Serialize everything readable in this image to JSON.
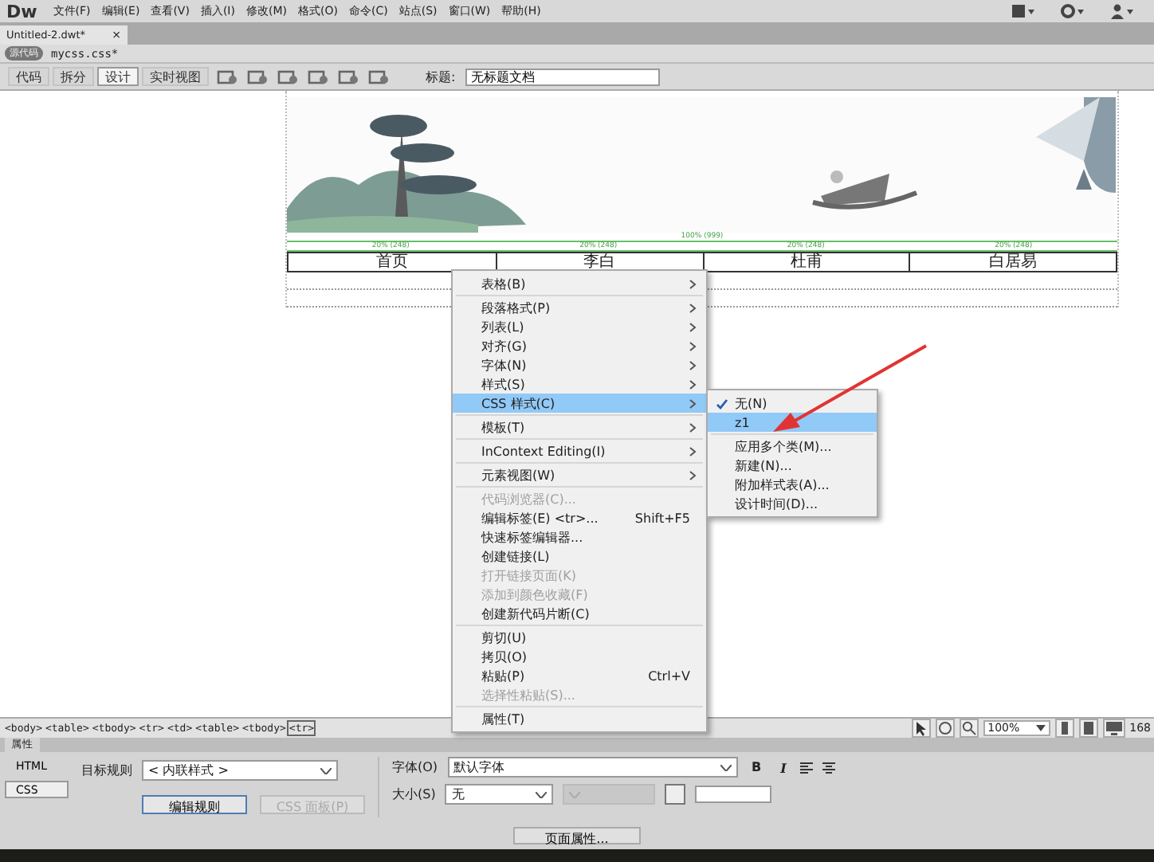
{
  "menubar": {
    "logo": "Dw",
    "menus": [
      "文件(F)",
      "编辑(E)",
      "查看(V)",
      "插入(I)",
      "修改(M)",
      "格式(O)",
      "命令(C)",
      "站点(S)",
      "窗口(W)",
      "帮助(H)"
    ]
  },
  "document_tab": {
    "title": "Untitled-2.dwt*",
    "close": "×"
  },
  "related_files": {
    "source": "源代码",
    "files": [
      "mycss.css*"
    ]
  },
  "doc_toolbar": {
    "views": [
      {
        "label": "代码",
        "selected": false
      },
      {
        "label": "拆分",
        "selected": false
      },
      {
        "label": "设计",
        "selected": true
      },
      {
        "label": "实时视图",
        "selected": false
      }
    ],
    "title_label": "标题:",
    "title_value": "无标题文档"
  },
  "page": {
    "table_width": "100% (999)",
    "column_widths": [
      "20% (248)",
      "20% (248)",
      "20% (248)",
      "20% (248)"
    ],
    "nav_cells": [
      "首页",
      "李白",
      "杜甫",
      "白居易"
    ]
  },
  "context_menu": {
    "groups": [
      [
        {
          "label": "表格(B)",
          "submenu": true,
          "disabled": false,
          "selected": false
        }
      ],
      [
        {
          "label": "段落格式(P)",
          "submenu": true,
          "disabled": false,
          "selected": false
        },
        {
          "label": "列表(L)",
          "submenu": true,
          "disabled": false,
          "selected": false
        },
        {
          "label": "对齐(G)",
          "submenu": true,
          "disabled": false,
          "selected": false
        },
        {
          "label": "字体(N)",
          "submenu": true,
          "disabled": false,
          "selected": false
        },
        {
          "label": "样式(S)",
          "submenu": true,
          "disabled": false,
          "selected": false
        },
        {
          "label": "CSS 样式(C)",
          "submenu": true,
          "disabled": false,
          "selected": true
        }
      ],
      [
        {
          "label": "模板(T)",
          "submenu": true,
          "disabled": false,
          "selected": false
        }
      ],
      [
        {
          "label": "InContext Editing(I)",
          "submenu": true,
          "disabled": false,
          "selected": false
        }
      ],
      [
        {
          "label": "元素视图(W)",
          "submenu": true,
          "disabled": false,
          "selected": false
        }
      ],
      [
        {
          "label": "代码浏览器(C)...",
          "submenu": false,
          "disabled": true,
          "selected": false
        },
        {
          "label": "编辑标签(E) <tr>...",
          "shortcut": "Shift+F5",
          "submenu": false,
          "disabled": false,
          "selected": false
        },
        {
          "label": "快速标签编辑器...",
          "submenu": false,
          "disabled": false,
          "selected": false
        },
        {
          "label": "创建链接(L)",
          "submenu": false,
          "disabled": false,
          "selected": false
        },
        {
          "label": "打开链接页面(K)",
          "submenu": false,
          "disabled": true,
          "selected": false
        },
        {
          "label": "添加到颜色收藏(F)",
          "submenu": false,
          "disabled": true,
          "selected": false
        },
        {
          "label": "创建新代码片断(C)",
          "submenu": false,
          "disabled": false,
          "selected": false
        }
      ],
      [
        {
          "label": "剪切(U)",
          "submenu": false,
          "disabled": false,
          "selected": false
        },
        {
          "label": "拷贝(O)",
          "submenu": false,
          "disabled": false,
          "selected": false
        },
        {
          "label": "粘贴(P)",
          "shortcut": "Ctrl+V",
          "submenu": false,
          "disabled": false,
          "selected": false
        },
        {
          "label": "选择性粘贴(S)...",
          "submenu": false,
          "disabled": true,
          "selected": false
        }
      ],
      [
        {
          "label": "属性(T)",
          "submenu": false,
          "disabled": false,
          "selected": false
        }
      ]
    ]
  },
  "css_submenu": {
    "groups": [
      [
        {
          "label": "无(N)",
          "checked": true,
          "selected": false
        },
        {
          "label": "z1",
          "checked": false,
          "selected": true
        }
      ],
      [
        {
          "label": "应用多个类(M)...",
          "checked": false,
          "selected": false
        },
        {
          "label": "新建(N)...",
          "checked": false,
          "selected": false
        },
        {
          "label": "附加样式表(A)...",
          "checked": false,
          "selected": false
        },
        {
          "label": "设计时间(D)...",
          "checked": false,
          "selected": false
        }
      ]
    ]
  },
  "status_bar": {
    "tags": [
      {
        "label": "<body>",
        "selected": false
      },
      {
        "label": "<table>",
        "selected": false
      },
      {
        "label": "<tbody>",
        "selected": false
      },
      {
        "label": "<tr>",
        "selected": false
      },
      {
        "label": "<td>",
        "selected": false
      },
      {
        "label": "<table>",
        "selected": false
      },
      {
        "label": "<tbody>",
        "selected": false
      },
      {
        "label": "<tr>",
        "selected": true
      }
    ],
    "zoom": "100%",
    "size": "168"
  },
  "properties": {
    "tab": "属性",
    "modes": [
      {
        "label": "HTML",
        "selected": false
      },
      {
        "label": "CSS",
        "selected": true
      }
    ],
    "target_rule_label": "目标规则",
    "target_rule": "< 内联样式 >",
    "edit_rule": "编辑规则",
    "css_panel": {
      "label": "CSS 面板(P)",
      "disabled": true
    },
    "font_label": "字体(O)",
    "font": "默认字体",
    "format_buttons": [
      "B",
      "I"
    ],
    "size_label": "大小(S)",
    "size": "无",
    "page_props": "页面属性..."
  }
}
